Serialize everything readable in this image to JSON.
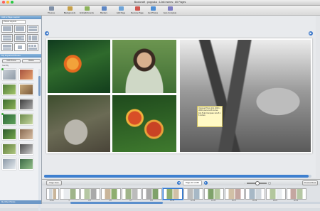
{
  "window": {
    "title": "Bookcraft : poppuka : 12x8 Inches : 80 Pages",
    "light_colors": [
      "#ff5f57",
      "#febc2e",
      "#28c840"
    ]
  },
  "toolbar": {
    "items": [
      {
        "label": "Themes",
        "icon": "themes-icon",
        "color": "#7f8fa6"
      },
      {
        "label": "Backgrounds",
        "icon": "backgrounds-icon",
        "color": "#c7a047"
      },
      {
        "label": "Embellishments",
        "icon": "embellishments-icon",
        "color": "#8cb35a"
      },
      {
        "label": "Borders",
        "icon": "borders-icon",
        "color": "#5d86c4"
      },
      {
        "label": "Add Page",
        "icon": "add-page-icon",
        "color": "#6ea4d8"
      },
      {
        "label": "Remove Page",
        "icon": "remove-page-icon",
        "color": "#d0574f"
      },
      {
        "label": "Get Photos",
        "icon": "get-photos-icon",
        "color": "#4d8fd6"
      },
      {
        "label": "Auto Complete",
        "icon": "auto-complete-icon",
        "color": "#7d7dc4"
      }
    ]
  },
  "sidebar": {
    "layouts_header": "Add a Page Layout",
    "layout_select": "Picture Layouts",
    "photos_header": "My Imported Photos",
    "buttons": [
      "Add Photos",
      "Delete"
    ],
    "sort_label": "Sort By",
    "footer": "My Other Photos"
  },
  "canvas": {
    "tooltip": "Optional Photo Info 4000 x 3000 pixels 12x8 inches 112.5 dpi Compare size 8 x 6 inches"
  },
  "pagebar": {
    "page_view_label": "Page View",
    "page_label": "Page 10 of 80",
    "preview_label": "Preview Book",
    "zoom_level": 0.5
  },
  "scroll": {
    "canvas_position": 0.99
  },
  "filmstrip": {
    "pages": [
      "Cover",
      "1",
      "2-3",
      "4-5",
      "6-7",
      "8-9",
      "10-11",
      "12-13",
      "14-15",
      "16-17",
      "18-19",
      "20-21",
      "22-23"
    ],
    "active_index": 6
  }
}
